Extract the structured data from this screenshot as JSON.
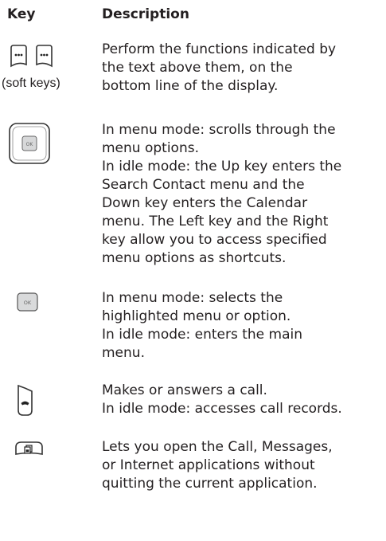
{
  "headers": {
    "key": "Key",
    "description": "Description"
  },
  "rows": [
    {
      "key_icon": "soft-keys-icon",
      "key_caption": "(soft keys)",
      "description": "Perform the functions indicated by\nthe text above them, on the\nbottom line of the display."
    },
    {
      "key_icon": "navigation-key-icon",
      "description": "In menu mode: scrolls through the\nmenu options.\nIn idle mode: the Up key enters the\nSearch Contact menu and the\nDown key enters the Calendar\nmenu. The Left key and the Right\nkey allow you to access specified\nmenu options as shortcuts."
    },
    {
      "key_icon": "ok-key-icon",
      "description": "In menu mode: selects the\nhighlighted menu or option.\nIn idle mode: enters the main\nmenu."
    },
    {
      "key_icon": "dial-key-icon",
      "description": "Makes or answers a call.\nIn idle mode: accesses call records."
    },
    {
      "key_icon": "multitasking-key-icon",
      "description": "Lets you open the Call, Messages,\nor Internet applications without\nquitting the current application."
    }
  ]
}
